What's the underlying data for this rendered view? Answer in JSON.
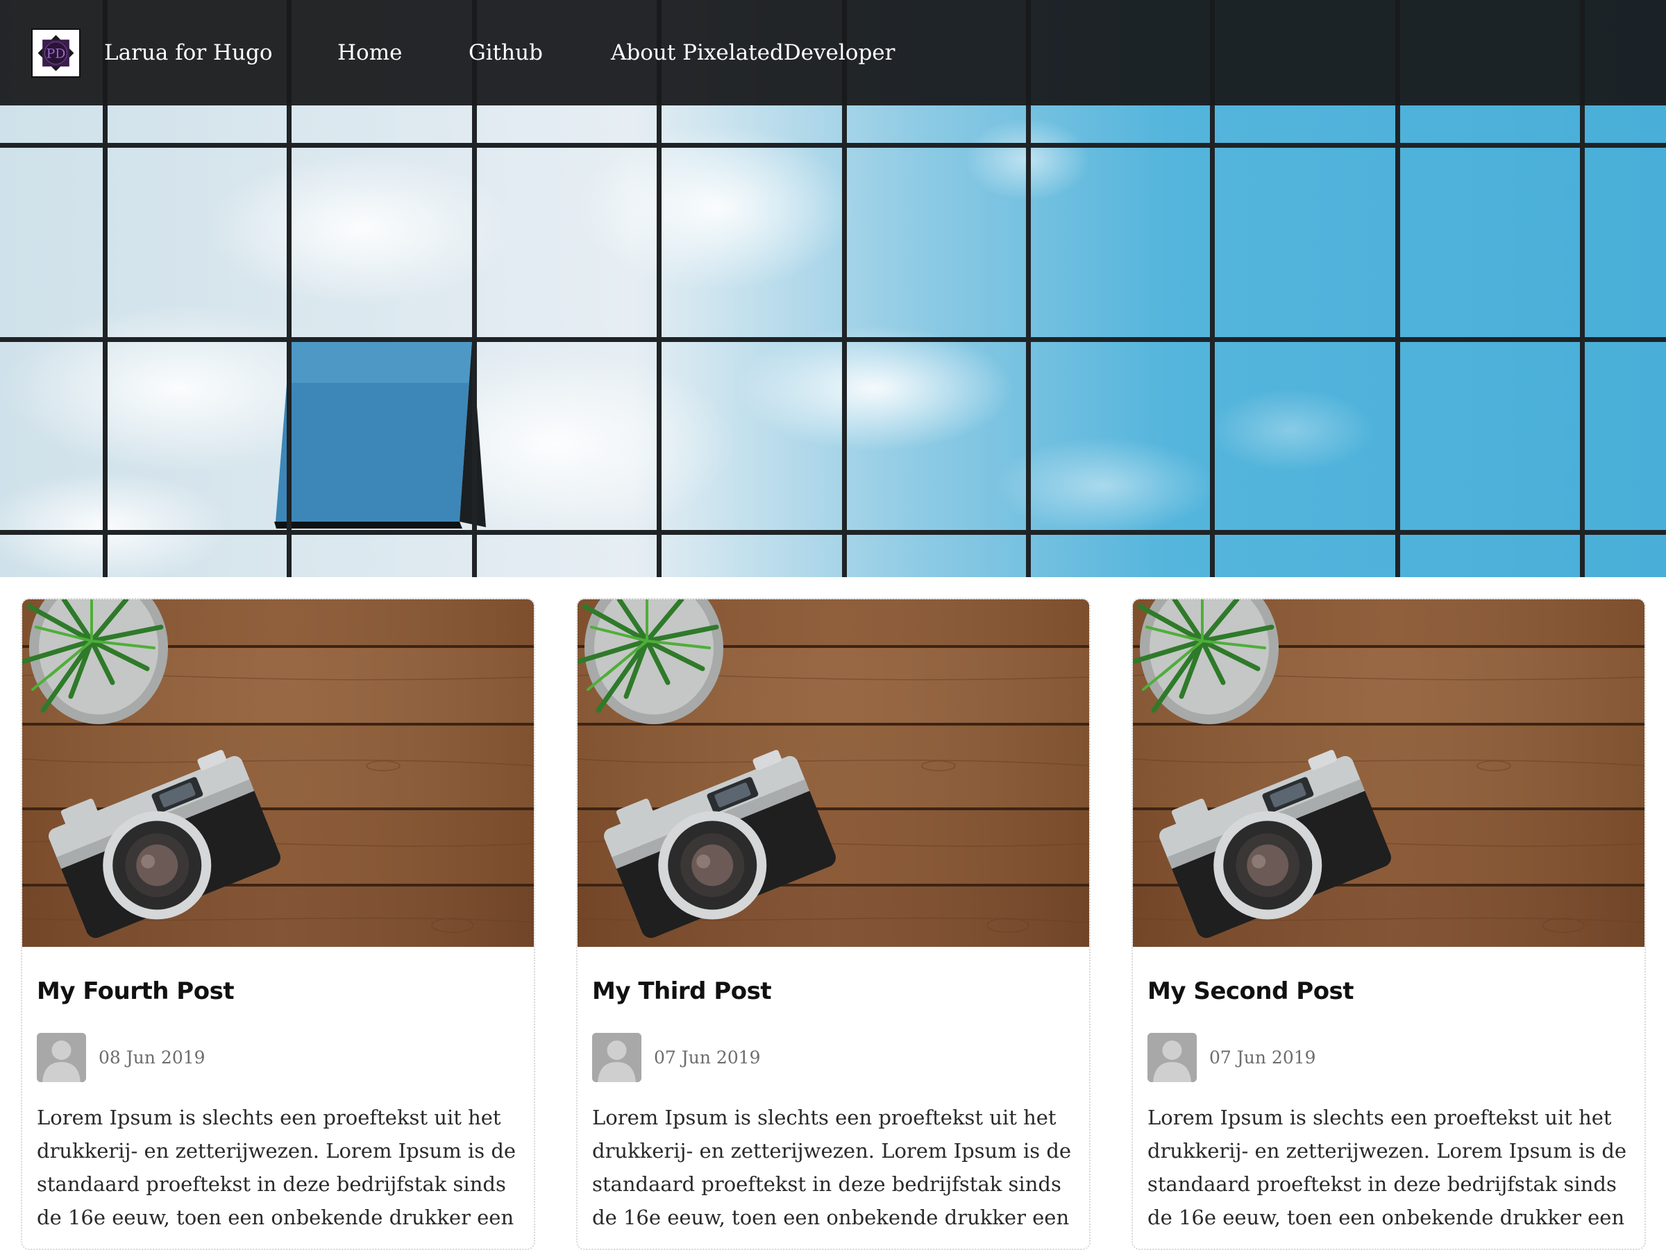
{
  "navbar": {
    "brand_label": "Larua for Hugo",
    "logo_text": "PD",
    "links": [
      {
        "label": "Home"
      },
      {
        "label": "Github"
      },
      {
        "label": "About PixelatedDeveloper"
      }
    ],
    "background_color": "#181a1c"
  },
  "hero": {
    "description_colors": {
      "sky_left": "#dbe8ef",
      "sky_right": "#4db1db",
      "frame": "#1e2124"
    }
  },
  "posts": [
    {
      "title": "My Fourth Post",
      "date": "08 Jun 2019",
      "excerpt_lines": [
        "Lorem Ipsum is slechts een proeftekst uit het",
        "drukkerij- en zetterijwezen. Lorem Ipsum is de",
        "standaard proeftekst in deze bedrijfstak sinds",
        "de 16e eeuw, toen een onbekende drukker een"
      ]
    },
    {
      "title": "My Third Post",
      "date": "07 Jun 2019",
      "excerpt_lines": [
        "Lorem Ipsum is slechts een proeftekst uit het",
        "drukkerij- en zetterijwezen. Lorem Ipsum is de",
        "standaard proeftekst in deze bedrijfstak sinds",
        "de 16e eeuw, toen een onbekende drukker een"
      ]
    },
    {
      "title": "My Second Post",
      "date": "07 Jun 2019",
      "excerpt_lines": [
        "Lorem Ipsum is slechts een proeftekst uit het",
        "drukkerij- en zetterijwezen. Lorem Ipsum is de",
        "standaard proeftekst in deze bedrijfstak sinds",
        "de 16e eeuw, toen een onbekende drukker een"
      ]
    }
  ],
  "icons": {
    "logo": "pd-logo-icon",
    "avatar": "user-avatar-icon",
    "card_image": "camera-on-wooden-table-image"
  }
}
